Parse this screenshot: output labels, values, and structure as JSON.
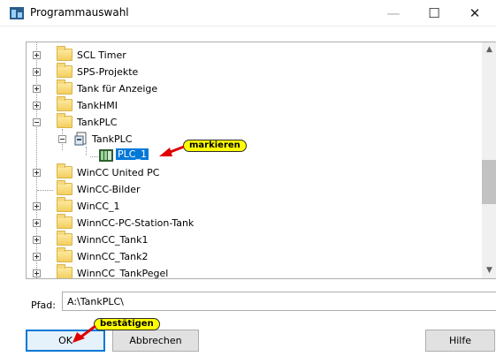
{
  "window": {
    "title": "Programmauswahl",
    "minimize_glyph": "—",
    "maximize_glyph": "☐",
    "close_glyph": "✕"
  },
  "tree": {
    "items": [
      {
        "label": "SCL Timer",
        "expander": "plus",
        "icon": "folder-icon"
      },
      {
        "label": "SPS-Projekte",
        "expander": "plus",
        "icon": "folder-icon"
      },
      {
        "label": "Tank für Anzeige",
        "expander": "plus",
        "icon": "folder-icon"
      },
      {
        "label": "TankHMI",
        "expander": "plus",
        "icon": "folder-icon"
      },
      {
        "label": "TankPLC",
        "expander": "minus",
        "icon": "folder-icon"
      },
      {
        "label": "TankPLC",
        "expander": "minus",
        "icon": "project-icon"
      },
      {
        "label": "PLC_1",
        "expander": "none",
        "icon": "plc-icon",
        "selected": true
      },
      {
        "label": "WinCC United PC",
        "expander": "plus",
        "icon": "folder-icon"
      },
      {
        "label": "WinCC-Bilder",
        "expander": "none",
        "icon": "folder-icon"
      },
      {
        "label": "WinCC_1",
        "expander": "plus",
        "icon": "folder-icon"
      },
      {
        "label": "WinnCC-PC-Station-Tank",
        "expander": "plus",
        "icon": "folder-icon"
      },
      {
        "label": "WinnCC_Tank1",
        "expander": "plus",
        "icon": "folder-icon"
      },
      {
        "label": "WinnCC_Tank2",
        "expander": "plus",
        "icon": "folder-icon"
      },
      {
        "label": "WinnCC_TankPegel",
        "expander": "plus",
        "icon": "folder-icon"
      }
    ],
    "scroll_up_glyph": "▲",
    "scroll_down_glyph": "▼"
  },
  "path": {
    "label": "Pfad:",
    "value": "A:\\TankPLC\\"
  },
  "buttons": {
    "ok": "OK",
    "cancel": "Abbrechen",
    "help": "Hilfe"
  },
  "annotations": {
    "select_hint": "markieren",
    "confirm_hint": "bestätigen"
  },
  "colors": {
    "selection": "#0078d7",
    "callout": "#ffff00",
    "arrow": "#e00000"
  }
}
